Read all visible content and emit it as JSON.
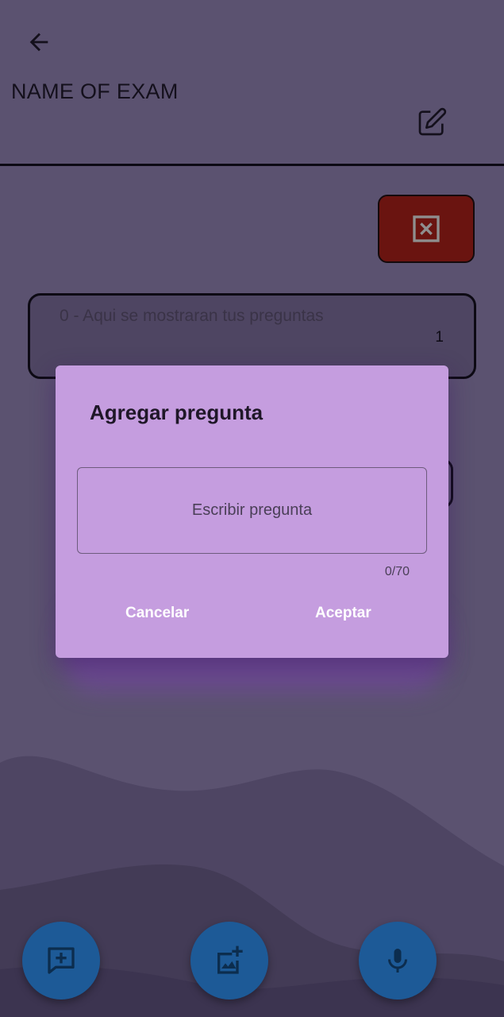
{
  "header": {
    "back_icon": "arrow-left-icon",
    "title": "NAME OF EXAM",
    "edit_icon": "edit-square-icon"
  },
  "actions": {
    "delete_icon": "close-box-icon",
    "delete_color": "#6a1410"
  },
  "questions": [
    {
      "text": "0 - Aqui se mostraran tus preguntas",
      "number": "1"
    }
  ],
  "dialog": {
    "title": "Agregar pregunta",
    "input_placeholder": "Escribir pregunta",
    "input_value": "",
    "counter": "0/70",
    "cancel_label": "Cancelar",
    "accept_label": "Aceptar",
    "background": "#c59ddf"
  },
  "fabs": [
    {
      "icon": "add-comment-icon"
    },
    {
      "icon": "add-photo-icon"
    },
    {
      "icon": "microphone-icon"
    }
  ],
  "colors": {
    "fab": "#1d5a97",
    "background": "#5b5270"
  }
}
